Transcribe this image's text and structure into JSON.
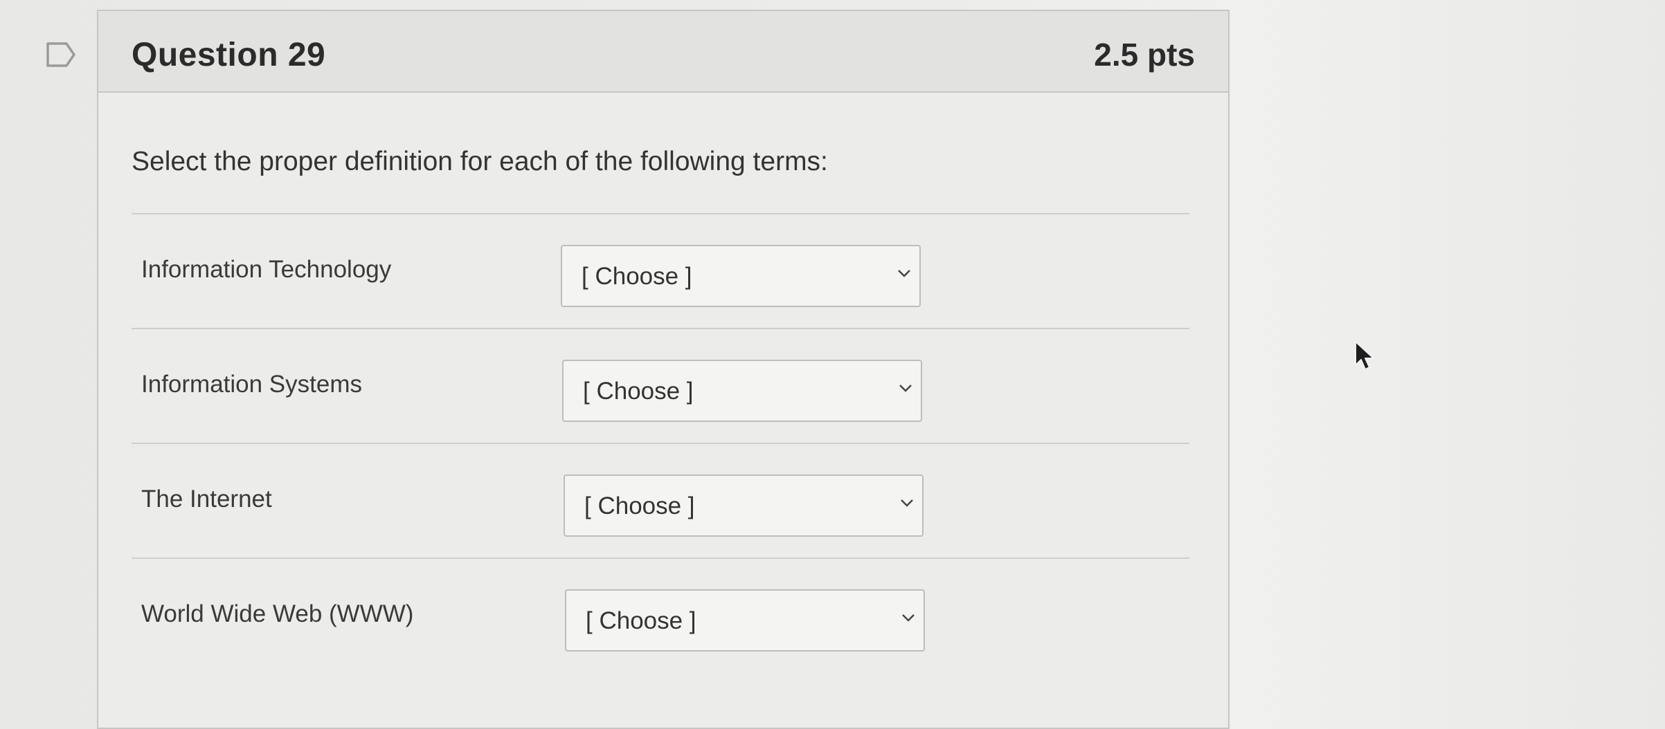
{
  "question": {
    "title": "Question 29",
    "points": "2.5 pts",
    "prompt": "Select the proper definition for each of the following terms:",
    "icons": {
      "flag": "flag-outline-icon",
      "dropdown": "chevron-down-icon",
      "cursor": "mouse-pointer-icon"
    },
    "rows": [
      {
        "term": "Information Technology",
        "selected": "[ Choose ]"
      },
      {
        "term": "Information Systems",
        "selected": "[ Choose ]"
      },
      {
        "term": "The Internet",
        "selected": "[ Choose ]"
      },
      {
        "term": "World Wide Web (WWW)",
        "selected": "[ Choose ]"
      }
    ]
  }
}
